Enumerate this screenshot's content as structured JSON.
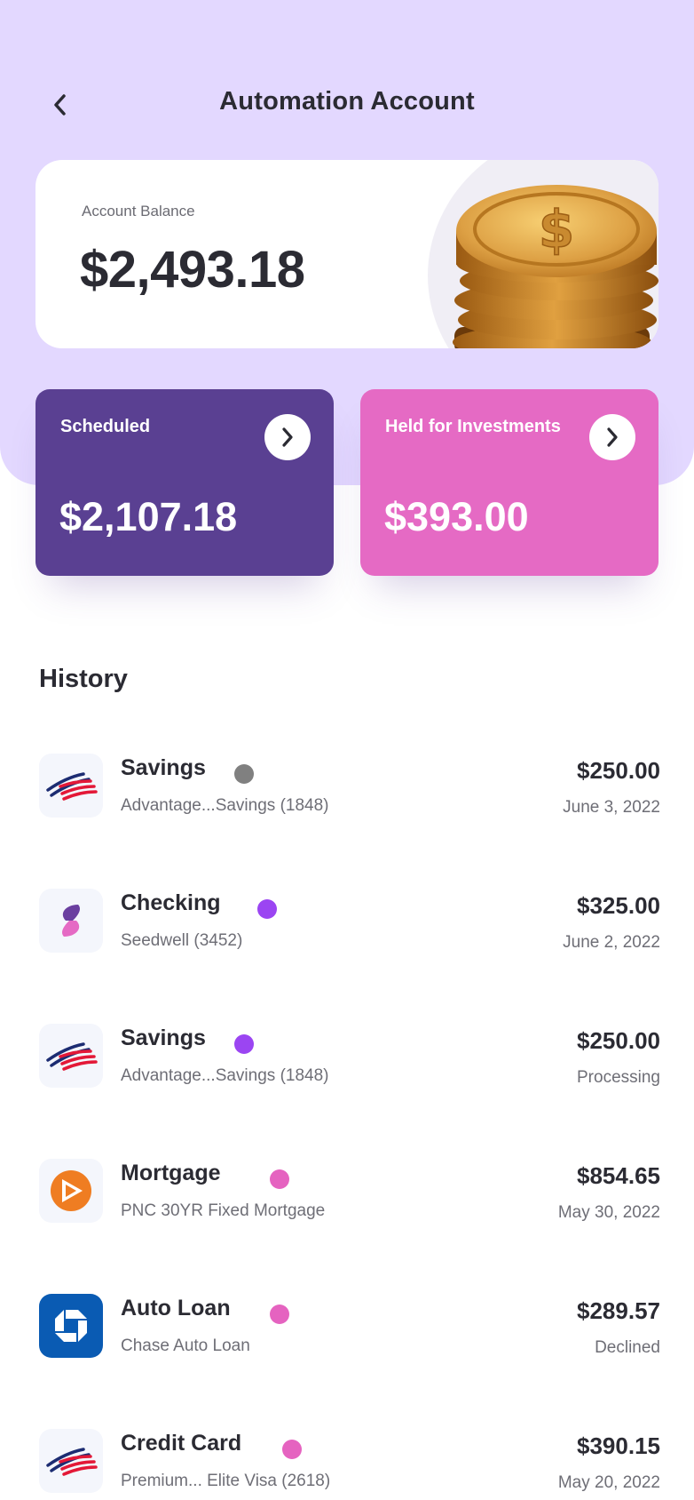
{
  "header": {
    "title": "Automation Account",
    "back_icon": "chevron-left-icon"
  },
  "balance": {
    "label": "Account Balance",
    "value": "$2,493.18",
    "image": "gold-coins-stack"
  },
  "summary": {
    "scheduled": {
      "label": "Scheduled",
      "value": "$2,107.18",
      "color": "#5a4092"
    },
    "held": {
      "label": "Held for Investments",
      "value": "$393.00",
      "color": "#e56ac4"
    }
  },
  "history": {
    "title": "History",
    "items": [
      {
        "title": "Savings",
        "subtitle": "Advantage...Savings (1848)",
        "amount": "$250.00",
        "date": "June 3, 2022",
        "dot_color": "#808080",
        "logo": "bank-of-america-logo"
      },
      {
        "title": "Checking",
        "subtitle": "Seedwell (3452)",
        "amount": "$325.00",
        "date": "June 2, 2022",
        "dot_color": "#9b45f2",
        "logo": "seedwell-logo"
      },
      {
        "title": "Savings",
        "subtitle": "Advantage...Savings (1848)",
        "amount": "$250.00",
        "date": "Processing",
        "dot_color": "#9b45f2",
        "logo": "bank-of-america-logo"
      },
      {
        "title": "Mortgage",
        "subtitle": "PNC 30YR Fixed Mortgage",
        "amount": "$854.65",
        "date": "May 30, 2022",
        "dot_color": "#e563c0",
        "logo": "pnc-logo"
      },
      {
        "title": "Auto Loan",
        "subtitle": "Chase Auto Loan",
        "amount": "$289.57",
        "date": "Declined",
        "dot_color": "#e563c0",
        "logo": "chase-logo"
      },
      {
        "title": "Credit Card",
        "subtitle": "Premium... Elite Visa (2618)",
        "amount": "$390.15",
        "date": "May 20, 2022",
        "dot_color": "#e563c0",
        "logo": "bank-of-america-logo"
      }
    ]
  }
}
